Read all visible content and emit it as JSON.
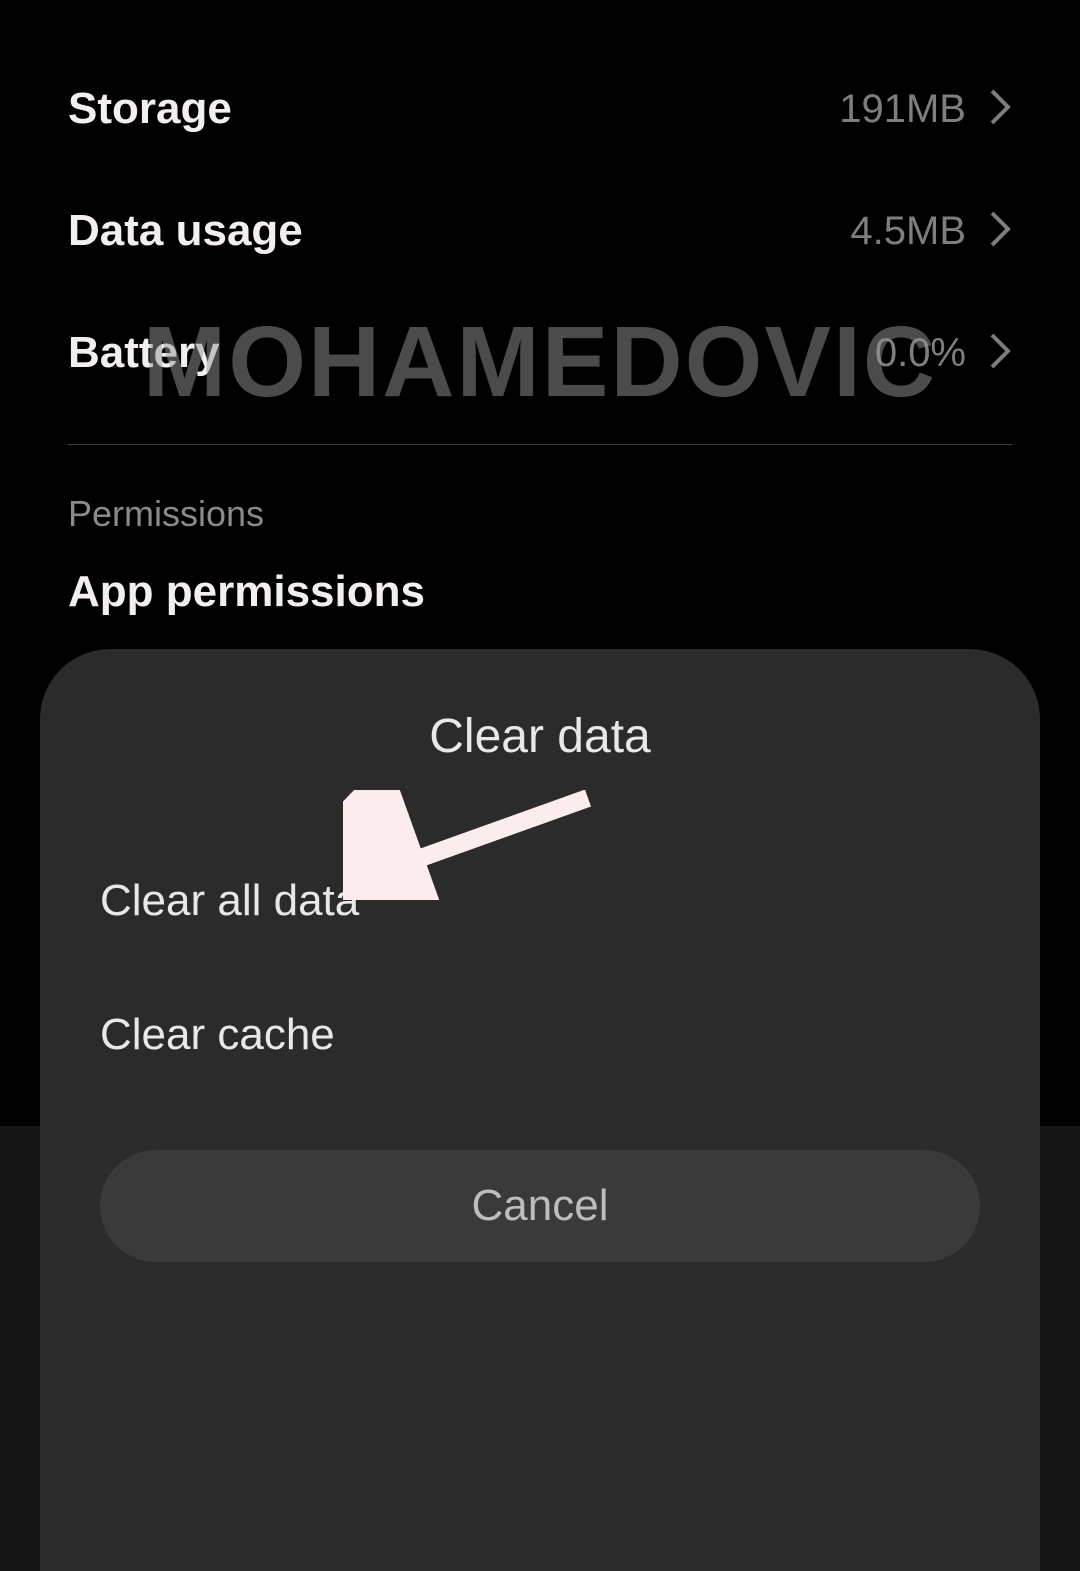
{
  "rows": {
    "storage": {
      "label": "Storage",
      "value": "191MB"
    },
    "data_usage": {
      "label": "Data usage",
      "value": "4.5MB"
    },
    "battery": {
      "label": "Battery",
      "value": "0.0%"
    }
  },
  "section": {
    "permissions_header": "Permissions",
    "app_permissions": "App permissions"
  },
  "dialog": {
    "title": "Clear data",
    "opt_clear_all": "Clear all data",
    "opt_clear_cache": "Clear cache",
    "cancel": "Cancel"
  },
  "watermark": "MOHAMEDOVIC"
}
